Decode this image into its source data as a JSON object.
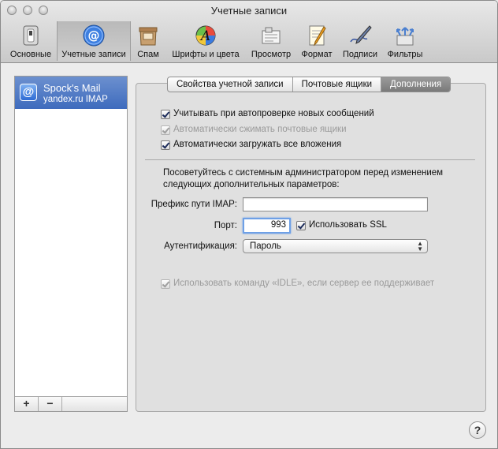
{
  "window": {
    "title": "Учетные записи"
  },
  "toolbar": {
    "items": [
      {
        "label": "Основные",
        "icon": "switch-icon"
      },
      {
        "label": "Учетные записи",
        "icon": "at-sign-icon",
        "selected": true
      },
      {
        "label": "Спам",
        "icon": "junk-mail-icon"
      },
      {
        "label": "Шрифты и цвета",
        "icon": "fonts-colors-icon"
      },
      {
        "label": "Просмотр",
        "icon": "viewing-icon"
      },
      {
        "label": "Формат",
        "icon": "composing-icon"
      },
      {
        "label": "Подписи",
        "icon": "signatures-icon"
      },
      {
        "label": "Фильтры",
        "icon": "rules-icon"
      }
    ]
  },
  "sidebar": {
    "accounts": [
      {
        "name": "Spock's Mail",
        "subtitle": "yandex.ru IMAP",
        "icon": "at-sign-icon"
      }
    ],
    "add_label": "+",
    "remove_label": "−"
  },
  "tabs": [
    {
      "label": "Свойства учетной записи"
    },
    {
      "label": "Почтовые ящики"
    },
    {
      "label": "Дополнения",
      "selected": true
    }
  ],
  "options": {
    "include_auto_check": {
      "label": "Учитывать при автопроверке новых сообщений",
      "checked": true,
      "enabled": true
    },
    "auto_compact": {
      "label": "Автоматически сжимать почтовые ящики",
      "checked": true,
      "enabled": false
    },
    "auto_download": {
      "label": "Автоматически загружать все вложения",
      "checked": true,
      "enabled": true
    }
  },
  "advanced_note": "Посоветуйтесь с системным администратором перед изменением следующих дополнительных параметров:",
  "imap_prefix": {
    "label": "Префикс пути IMAP:",
    "value": ""
  },
  "port": {
    "label": "Порт:",
    "value": "993"
  },
  "ssl": {
    "label": "Использовать SSL",
    "checked": true
  },
  "auth": {
    "label": "Аутентификация:",
    "value": "Пароль"
  },
  "idle": {
    "label": "Использовать команду «IDLE», если сервер ее поддерживает",
    "checked": true,
    "enabled": false
  },
  "help_label": "?"
}
